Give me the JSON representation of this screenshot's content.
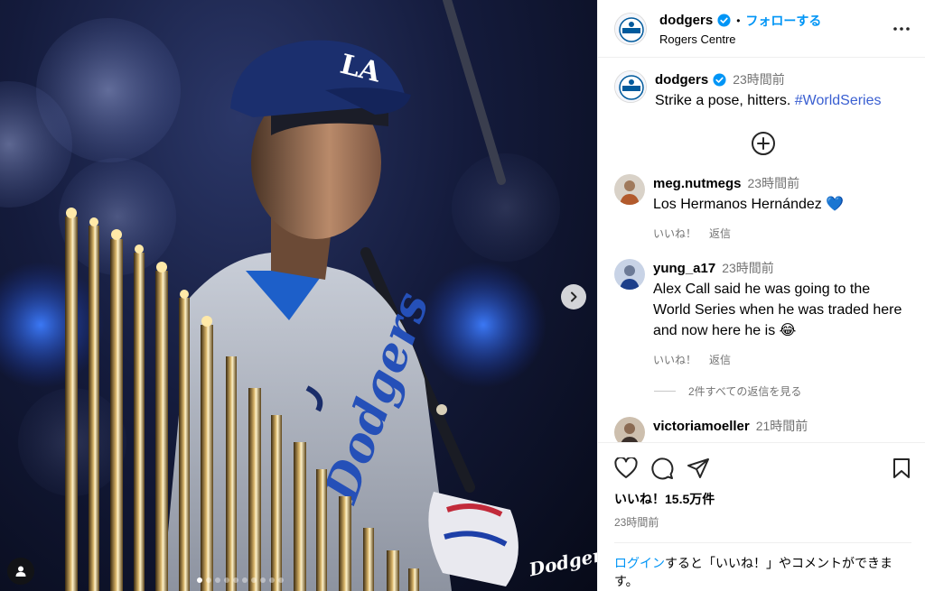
{
  "account": {
    "username": "dodgers",
    "follow_label": "フォローする",
    "separator": "•",
    "location": "Rogers Centre"
  },
  "caption": {
    "username": "dodgers",
    "time": "23時間前",
    "text": "Strike a pose, hitters.",
    "hashtag": "#WorldSeries"
  },
  "comments": [
    {
      "username": "meg.nutmegs",
      "time": "23時間前",
      "text": "Los Hermanos Hernández 💙",
      "like_label": "いいね！",
      "reply_label": "返信"
    },
    {
      "username": "yung_a17",
      "time": "23時間前",
      "text": "Alex Call said he was going to the World Series when he was traded here and now here he is 😂",
      "like_label": "いいね！",
      "reply_label": "返信",
      "view_replies_label": "2件すべての返信を見る"
    },
    {
      "username": "victoriamoeller",
      "time": "21時間前"
    }
  ],
  "footer": {
    "likes": "いいね！15.5万件",
    "posted": "23時間前",
    "login_link": "ログイン",
    "login_text": "すると「いいね！」やコメントができます。"
  },
  "media": {
    "wordmark": "Dodgers",
    "carousel_count": 10,
    "carousel_active": 0
  },
  "colors": {
    "accent": "#0095f6",
    "dodger_blue": "#005a9c",
    "verified": "#0095f6"
  },
  "icons": [
    "verified-badge-icon",
    "more-options-icon",
    "add-circle-icon",
    "heart-icon",
    "comment-icon",
    "share-icon",
    "bookmark-icon",
    "chevron-right-icon",
    "user-tag-icon"
  ]
}
